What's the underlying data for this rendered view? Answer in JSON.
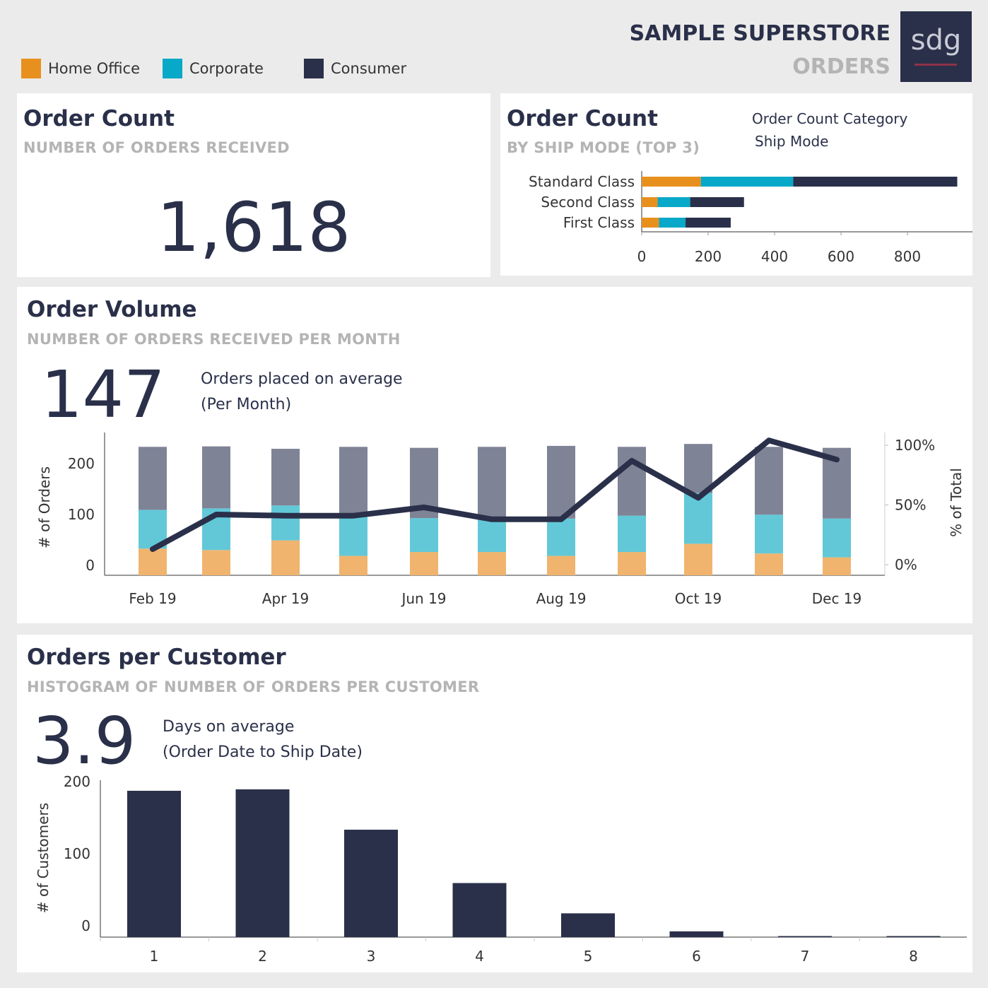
{
  "header": {
    "title": "SAMPLE SUPERSTORE",
    "subtitle": "ORDERS",
    "logo_text": "sdg",
    "legend": [
      {
        "label": "Home Office",
        "color": "#e8901e"
      },
      {
        "label": "Corporate",
        "color": "#08a8c8"
      },
      {
        "label": "Consumer",
        "color": "#2a3049"
      }
    ]
  },
  "order_count": {
    "title": "Order Count",
    "subtitle": "NUMBER OF ORDERS RECEIVED",
    "value": "1,618"
  },
  "ship_mode": {
    "title": "Order Count",
    "subtitle": "BY SHIP MODE (TOP 3)",
    "filter_label": "Order Count Category",
    "filter_value": "Ship Mode"
  },
  "order_volume": {
    "title": "Order Volume",
    "subtitle": "NUMBER OF ORDERS RECEIVED PER MONTH",
    "kpi_value": "147",
    "kpi_label": "Orders placed on average",
    "kpi_sublabel": "(Per Month)"
  },
  "orders_per_customer": {
    "title": "Orders per Customer",
    "subtitle": "HISTOGRAM OF NUMBER OF ORDERS PER CUSTOMER",
    "kpi_value": "3.9",
    "kpi_label": "Days on average",
    "kpi_sublabel": "(Order Date to Ship Date)"
  },
  "chart_data": [
    {
      "id": "ship_mode",
      "type": "bar",
      "orientation": "horizontal",
      "stacked": true,
      "categories": [
        "Standard Class",
        "Second Class",
        "First Class"
      ],
      "series": [
        {
          "name": "Home Office",
          "color": "#e8901e",
          "values": [
            178,
            48,
            52
          ]
        },
        {
          "name": "Corporate",
          "color": "#08a8c8",
          "values": [
            278,
            98,
            80
          ]
        },
        {
          "name": "Consumer",
          "color": "#2a3049",
          "values": [
            494,
            162,
            136
          ]
        }
      ],
      "xlim": [
        0,
        1000
      ],
      "xticks": [
        0,
        200,
        400,
        600,
        800
      ]
    },
    {
      "id": "order_volume",
      "type": "bar",
      "stacked": true,
      "x": [
        "Feb 19",
        "Mar 19",
        "Apr 19",
        "May 19",
        "Jun 19",
        "Jul 19",
        "Aug 19",
        "Sep 19",
        "Oct 19",
        "Nov 19",
        "Dec 19"
      ],
      "xtick_labels": [
        "Feb 19",
        "Apr 19",
        "Jun 19",
        "Aug 19",
        "Oct 19",
        "Dec 19"
      ],
      "series": [
        {
          "name": "Home Office",
          "color": "#f0b46e",
          "values": [
            55,
            52,
            72,
            40,
            48,
            48,
            40,
            48,
            65,
            45,
            37
          ]
        },
        {
          "name": "Corporate",
          "color": "#62c8d8",
          "values": [
            80,
            86,
            72,
            85,
            70,
            72,
            77,
            75,
            105,
            80,
            80
          ]
        },
        {
          "name": "Consumer",
          "color": "#7f8396",
          "values": [
            130,
            128,
            117,
            140,
            145,
            145,
            150,
            142,
            101,
            140,
            146
          ]
        }
      ],
      "line": {
        "axis": "right",
        "values": [
          13,
          42,
          41,
          41,
          48,
          38,
          38,
          87,
          56,
          104,
          88
        ]
      },
      "ylabel": "# of Orders",
      "yticks": [
        0,
        100,
        200
      ],
      "ylim": [
        0,
        280
      ],
      "y2label": "% of Total",
      "y2ticks": [
        "0%",
        "50%",
        "100%"
      ],
      "y2lim": [
        0,
        105
      ]
    },
    {
      "id": "orders_per_customer",
      "type": "bar",
      "categories": [
        "1",
        "2",
        "3",
        "4",
        "5",
        "6",
        "7",
        "8"
      ],
      "values": [
        203,
        205,
        149,
        75,
        33,
        8,
        1,
        1
      ],
      "ylabel": "# of Customers",
      "yticks": [
        0,
        100,
        200
      ],
      "ylim": [
        0,
        215
      ]
    }
  ]
}
